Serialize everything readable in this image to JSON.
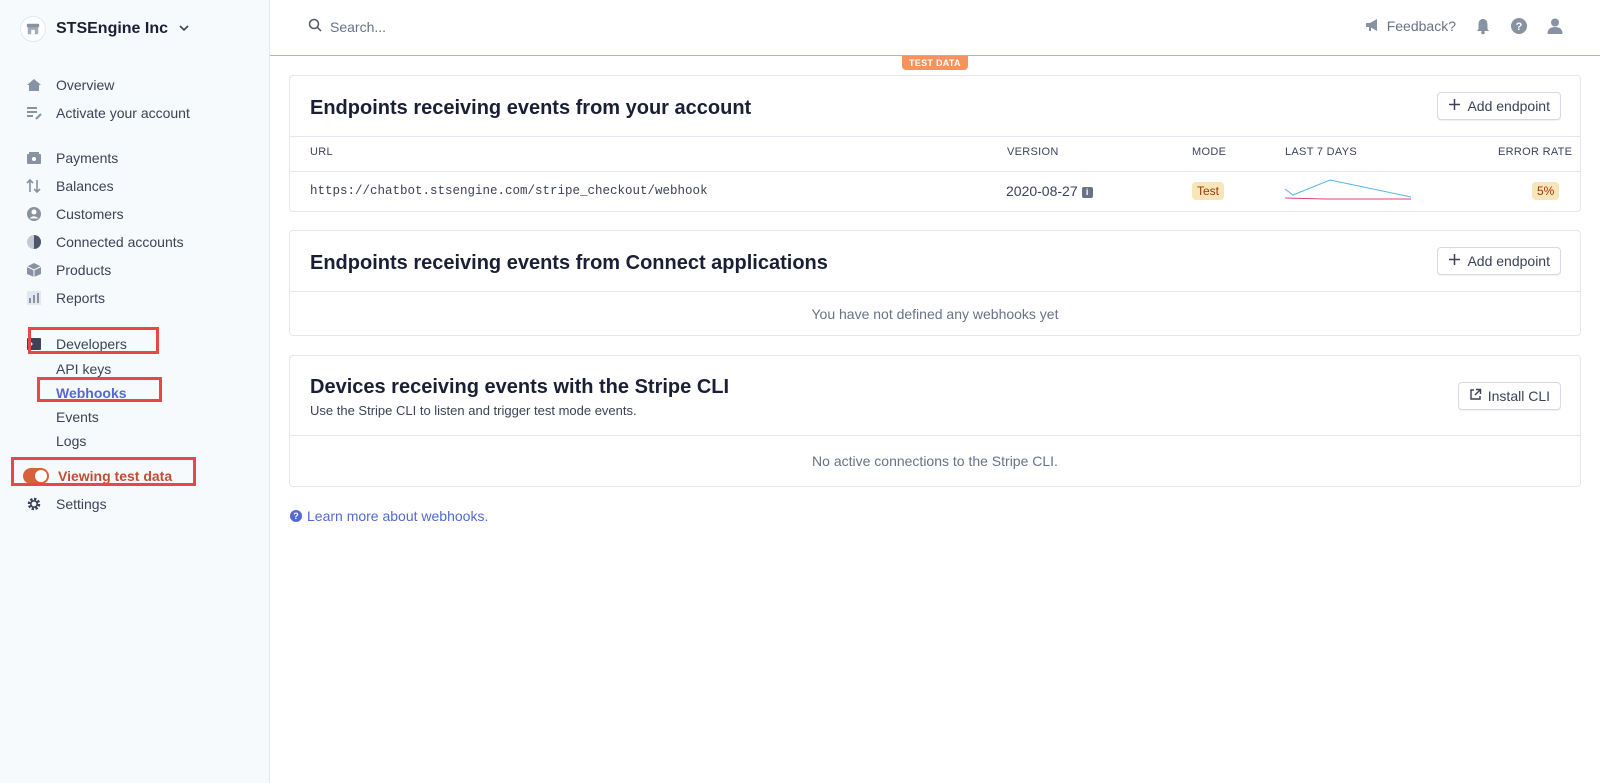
{
  "account": {
    "name": "STSEngine Inc"
  },
  "sidebar": {
    "primary": [
      {
        "label": "Overview",
        "icon": "home-icon"
      },
      {
        "label": "Activate your account",
        "icon": "checklist-icon"
      }
    ],
    "main": [
      {
        "label": "Payments",
        "icon": "payments-icon"
      },
      {
        "label": "Balances",
        "icon": "balances-icon"
      },
      {
        "label": "Customers",
        "icon": "customers-icon"
      },
      {
        "label": "Connected accounts",
        "icon": "connected-accounts-icon"
      },
      {
        "label": "Products",
        "icon": "products-icon"
      },
      {
        "label": "Reports",
        "icon": "reports-icon"
      }
    ],
    "developers": {
      "label": "Developers",
      "items": [
        "API keys",
        "Webhooks",
        "Events",
        "Logs"
      ],
      "active": "Webhooks"
    },
    "test_toggle": {
      "label": "Viewing test data",
      "on": true
    },
    "settings": {
      "label": "Settings"
    }
  },
  "header": {
    "search_placeholder": "Search...",
    "feedback_label": "Feedback?"
  },
  "test_badge": "TEST DATA",
  "account_endpoints": {
    "title": "Endpoints receiving events from your account",
    "add_button": "Add endpoint",
    "columns": [
      "URL",
      "VERSION",
      "MODE",
      "LAST 7 DAYS",
      "ERROR RATE"
    ],
    "rows": [
      {
        "url": "https://chatbot.stsengine.com/stripe_checkout/webhook",
        "version": "2020-08-27",
        "mode": "Test",
        "error_rate": "5%"
      }
    ]
  },
  "connect_endpoints": {
    "title": "Endpoints receiving events from Connect applications",
    "add_button": "Add endpoint",
    "empty": "You have not defined any webhooks yet"
  },
  "cli": {
    "title": "Devices receiving events with the Stripe CLI",
    "subtitle": "Use the Stripe CLI to listen and trigger test mode events.",
    "install_button": "Install CLI",
    "empty": "No active connections to the Stripe CLI."
  },
  "learn_more": "Learn more about webhooks.",
  "colors": {
    "accent": "#5469d4",
    "test_orange": "#f5925e",
    "highlight_red": "#e5474b",
    "toggle_on": "#d8613c"
  }
}
